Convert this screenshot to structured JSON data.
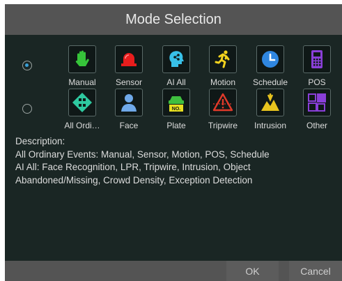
{
  "dialog": {
    "title": "Mode Selection"
  },
  "modes": {
    "row1": {
      "selected": true,
      "items": [
        {
          "label": "Manual",
          "icon": "hand-icon"
        },
        {
          "label": "Sensor",
          "icon": "alarm-light-icon"
        },
        {
          "label": "AI All",
          "icon": "ai-head-icon"
        },
        {
          "label": "Motion",
          "icon": "running-man-icon"
        },
        {
          "label": "Schedule",
          "icon": "clock-icon"
        },
        {
          "label": "POS",
          "icon": "pos-terminal-icon"
        }
      ]
    },
    "row2": {
      "selected": false,
      "items": [
        {
          "label": "All Ordi…",
          "icon": "all-ordinary-icon"
        },
        {
          "label": "Face",
          "icon": "face-person-icon"
        },
        {
          "label": "Plate",
          "icon": "license-plate-icon"
        },
        {
          "label": "Tripwire",
          "icon": "tripwire-warning-icon"
        },
        {
          "label": "Intrusion",
          "icon": "intrusion-icon"
        },
        {
          "label": "Other",
          "icon": "other-grid-icon"
        }
      ]
    }
  },
  "description": {
    "heading": "Description:",
    "line1": "All Ordinary Events: Manual, Sensor, Motion, POS, Schedule",
    "line2": "AI All: Face Recognition, LPR, Tripwire, Intrusion, Object",
    "line3": "Abandoned/Missing, Crowd Density, Exception Detection"
  },
  "footer": {
    "ok_label": "OK",
    "cancel_label": "Cancel"
  },
  "colors": {
    "dialog_bg": "#1a2624",
    "titlebar_bg": "#545454",
    "radio_selected": "#3aa0d8"
  }
}
